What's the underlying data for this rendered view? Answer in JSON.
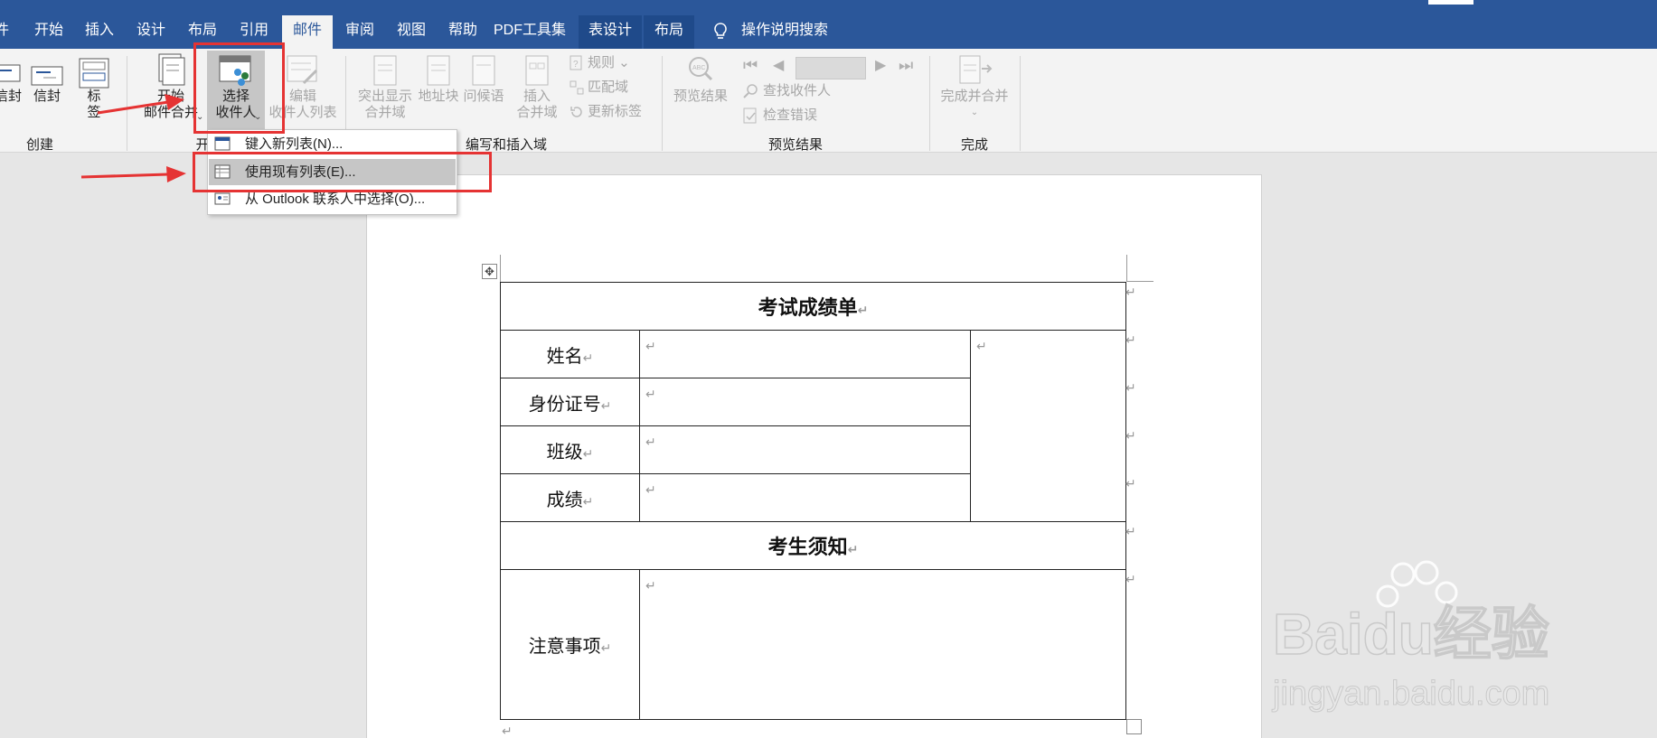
{
  "tabs": {
    "file": "件",
    "home": "开始",
    "insert": "插入",
    "design": "设计",
    "layout": "布局",
    "references": "引用",
    "mailings": "邮件",
    "review": "审阅",
    "view": "视图",
    "help": "帮助",
    "pdf": "PDF工具集",
    "table_design": "表设计",
    "table_layout": "布局",
    "tell_me": "操作说明搜索"
  },
  "ribbon": {
    "envelopes": "信封",
    "envelopes2": "信封",
    "labels": "标签",
    "create_group": "创建",
    "start_merge_line1": "开始",
    "start_merge_line2": "邮件合并",
    "select_recipients_line1": "选择",
    "select_recipients_line2": "收件人",
    "edit_list_line1": "编辑",
    "edit_list_line2": "收件人列表",
    "start_group_partial": "开",
    "highlight_line1": "突出显示",
    "highlight_line2": "合并域",
    "address_block": "地址块",
    "greeting_line": "问候语",
    "insert_field_line1": "插入",
    "insert_field_line2": "合并域",
    "rules": "规则",
    "match_fields": "匹配域",
    "update_labels": "更新标签",
    "write_group": "编写和插入域",
    "preview_results": "预览结果",
    "find_recipient": "查找收件人",
    "check_errors": "检查错误",
    "preview_group": "预览结果",
    "finish_merge": "完成并合并",
    "finish_group": "完成"
  },
  "menu": {
    "type_new_list": "键入新列表(N)...",
    "use_existing_list": "使用现有列表(E)...",
    "outlook_contacts": "从 Outlook 联系人中选择(O)..."
  },
  "document": {
    "title": "考试成绩单",
    "name_label": "姓名",
    "id_label": "身份证号",
    "class_label": "班级",
    "score_label": "成绩",
    "notice_title": "考生须知",
    "notes_label": "注意事项",
    "para_mark": "↵"
  },
  "watermark": {
    "brand_text": "Baidu经验",
    "url": "jingyan.baidu.com"
  },
  "colors": {
    "ribbon_blue": "#2b579a",
    "annotation_red": "#e53333"
  }
}
